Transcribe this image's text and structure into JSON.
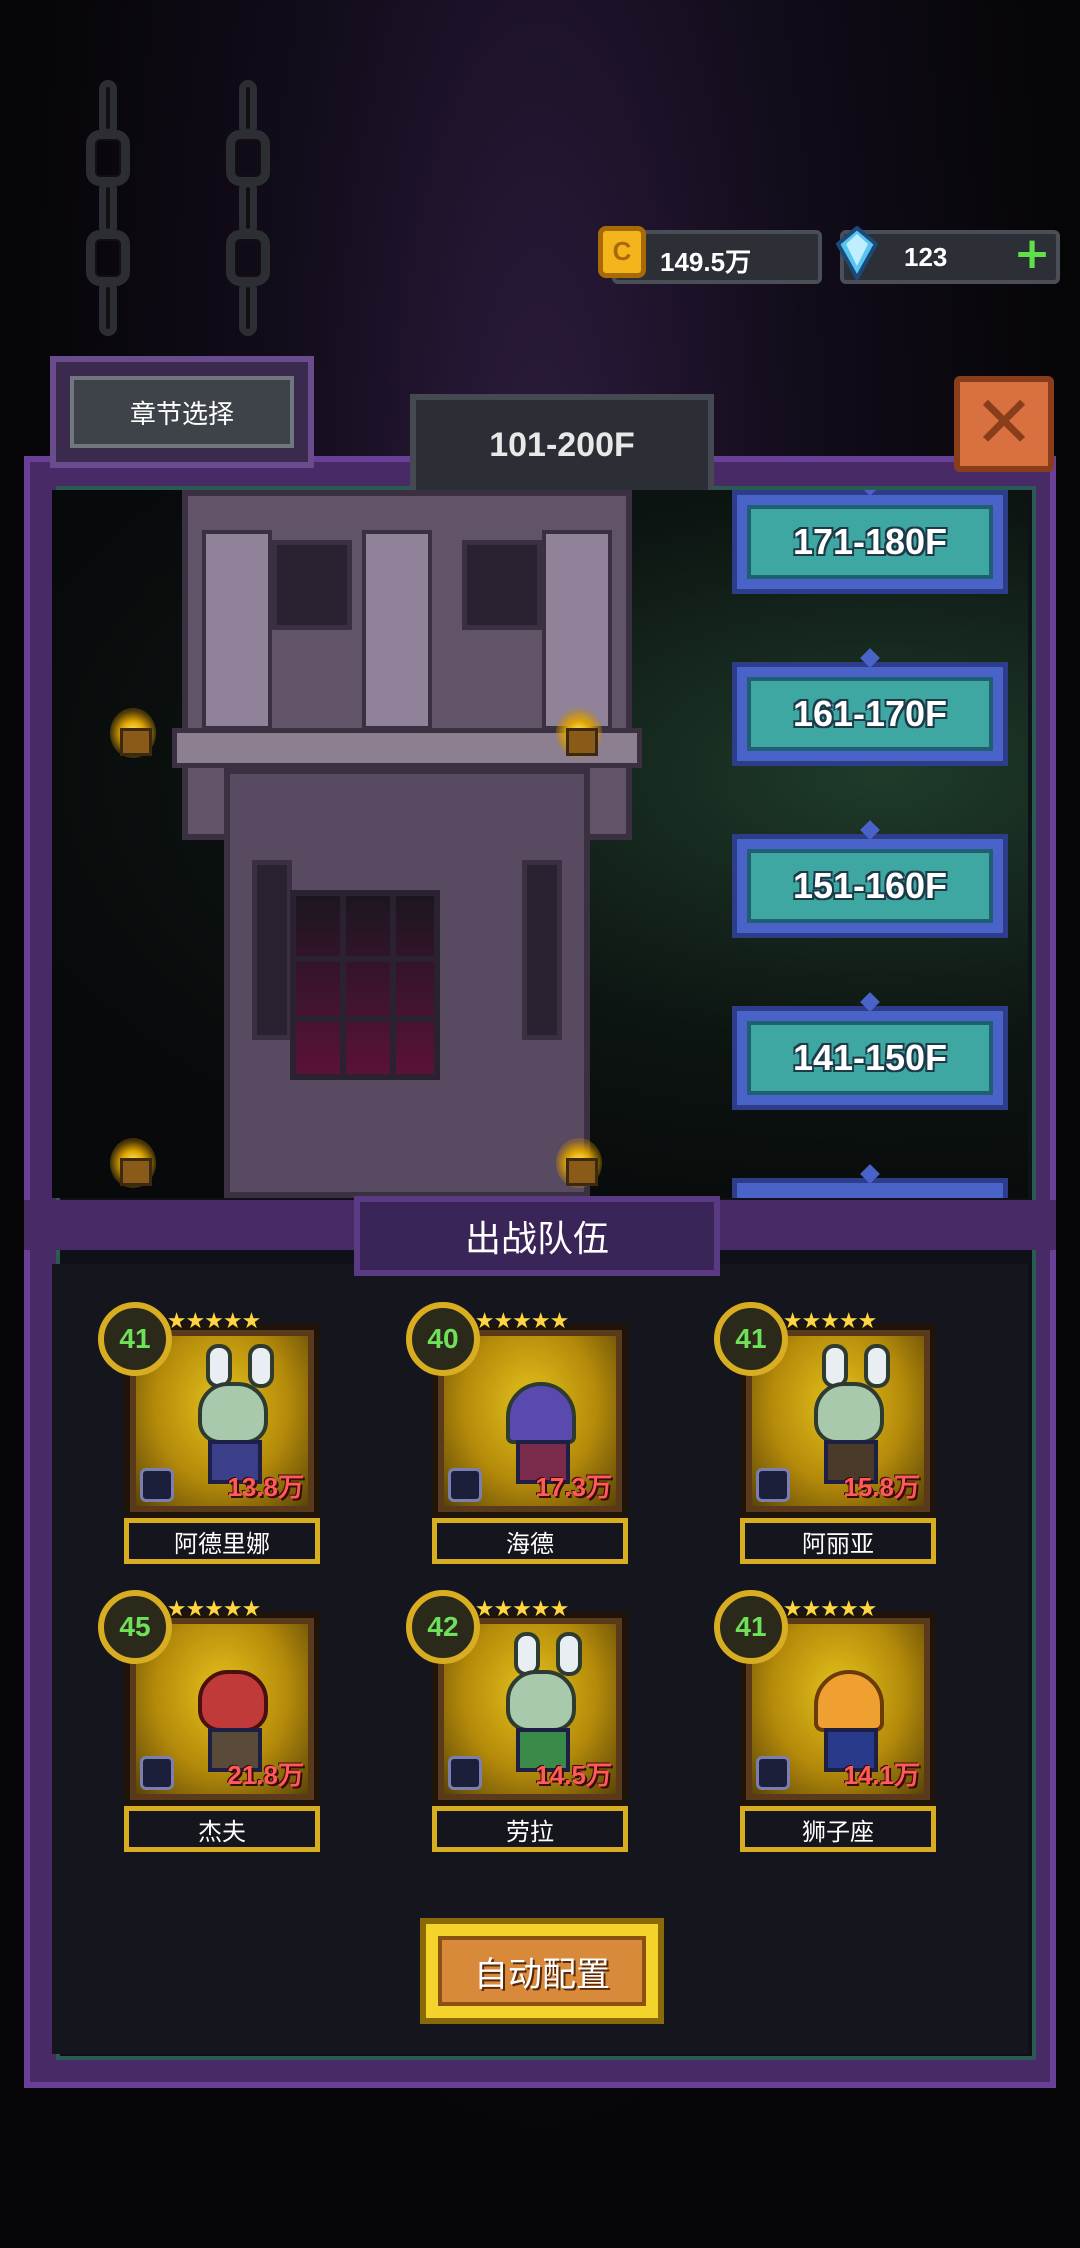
{
  "resources": {
    "coins": "149.5万",
    "gems": "123"
  },
  "header": {
    "chapter_select_label": "章节选择",
    "floor_range": "101-200F"
  },
  "floors": [
    {
      "label": "171-180F"
    },
    {
      "label": "161-170F"
    },
    {
      "label": "151-160F"
    },
    {
      "label": "141-150F"
    }
  ],
  "team": {
    "title": "出战队伍",
    "heroes": [
      {
        "name": "阿德里娜",
        "level": "41",
        "power": "13.8万"
      },
      {
        "name": "海德",
        "level": "40",
        "power": "17.3万"
      },
      {
        "name": "阿丽亚",
        "level": "41",
        "power": "15.8万"
      },
      {
        "name": "杰夫",
        "level": "45",
        "power": "21.8万"
      },
      {
        "name": "劳拉",
        "level": "42",
        "power": "14.5万"
      },
      {
        "name": "狮子座",
        "level": "41",
        "power": "14.1万"
      }
    ],
    "auto_config_label": "自动配置"
  },
  "colors": {
    "frame_purple": "#472a66",
    "floor_button": "#3fa7a2",
    "gold": "#d8ad22",
    "level_green": "#6ee05a",
    "power_red": "#ff5a5a"
  },
  "icons": [
    "coin-icon",
    "gem-icon",
    "plus-icon",
    "close-icon",
    "chain-icon",
    "torch-icon",
    "element-icon",
    "star-icon"
  ]
}
